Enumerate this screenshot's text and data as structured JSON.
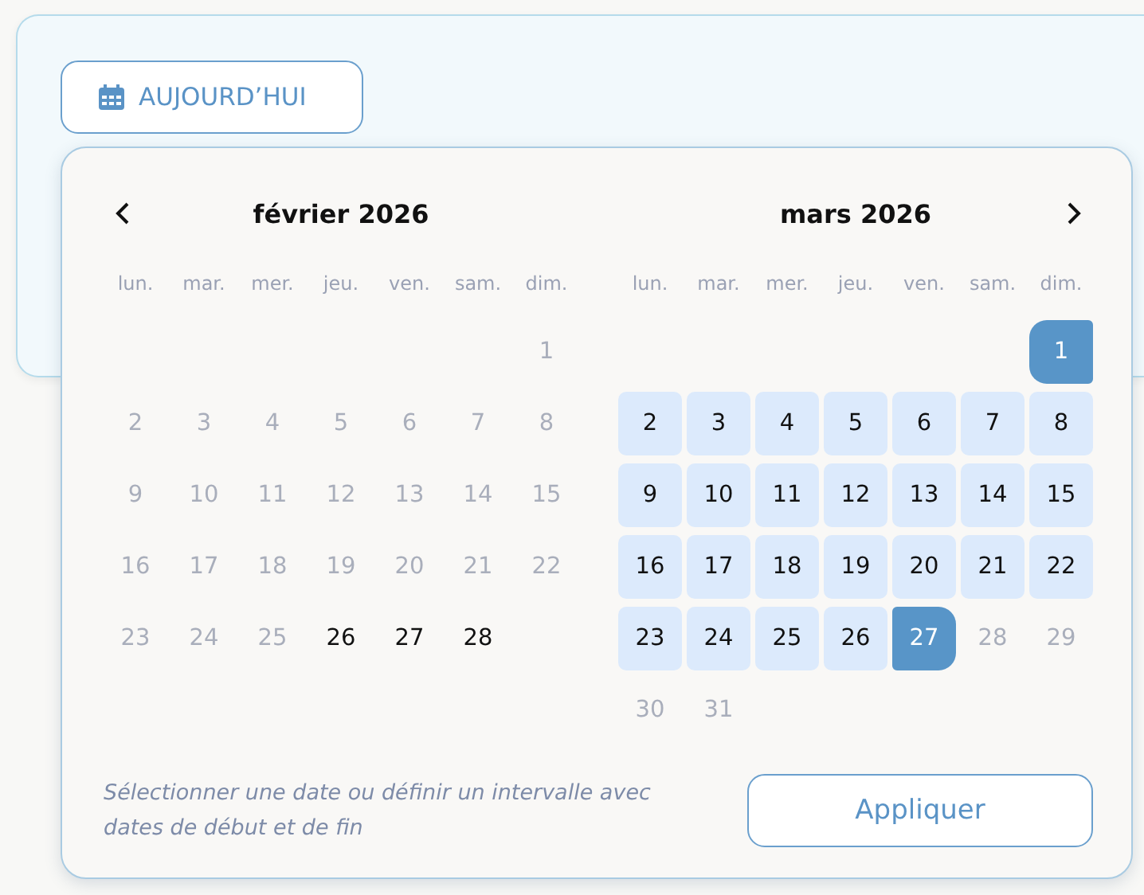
{
  "today_button": {
    "label": "AUJOURD’HUI"
  },
  "date_picker": {
    "months": [
      {
        "title": "février 2026",
        "weekdays": [
          "lun.",
          "mar.",
          "mer.",
          "jeu.",
          "ven.",
          "sam.",
          "dim."
        ],
        "weeks": [
          [
            {
              "kind": "blank"
            },
            {
              "kind": "blank"
            },
            {
              "kind": "blank"
            },
            {
              "kind": "blank"
            },
            {
              "kind": "blank"
            },
            {
              "kind": "blank"
            },
            {
              "kind": "muted",
              "label": "1"
            }
          ],
          [
            {
              "kind": "muted",
              "label": "2"
            },
            {
              "kind": "muted",
              "label": "3"
            },
            {
              "kind": "muted",
              "label": "4"
            },
            {
              "kind": "muted",
              "label": "5"
            },
            {
              "kind": "muted",
              "label": "6"
            },
            {
              "kind": "muted",
              "label": "7"
            },
            {
              "kind": "muted",
              "label": "8"
            }
          ],
          [
            {
              "kind": "muted",
              "label": "9"
            },
            {
              "kind": "muted",
              "label": "10"
            },
            {
              "kind": "muted",
              "label": "11"
            },
            {
              "kind": "muted",
              "label": "12"
            },
            {
              "kind": "muted",
              "label": "13"
            },
            {
              "kind": "muted",
              "label": "14"
            },
            {
              "kind": "muted",
              "label": "15"
            }
          ],
          [
            {
              "kind": "muted",
              "label": "16"
            },
            {
              "kind": "muted",
              "label": "17"
            },
            {
              "kind": "muted",
              "label": "18"
            },
            {
              "kind": "muted",
              "label": "19"
            },
            {
              "kind": "muted",
              "label": "20"
            },
            {
              "kind": "muted",
              "label": "21"
            },
            {
              "kind": "muted",
              "label": "22"
            }
          ],
          [
            {
              "kind": "muted",
              "label": "23"
            },
            {
              "kind": "muted",
              "label": "24"
            },
            {
              "kind": "muted",
              "label": "25"
            },
            {
              "kind": "plain",
              "label": "26"
            },
            {
              "kind": "plain",
              "label": "27"
            },
            {
              "kind": "plain",
              "label": "28"
            },
            {
              "kind": "blank"
            }
          ]
        ]
      },
      {
        "title": "mars 2026",
        "weekdays": [
          "lun.",
          "mar.",
          "mer.",
          "jeu.",
          "ven.",
          "sam.",
          "dim."
        ],
        "weeks": [
          [
            {
              "kind": "blank"
            },
            {
              "kind": "blank"
            },
            {
              "kind": "blank"
            },
            {
              "kind": "blank"
            },
            {
              "kind": "blank"
            },
            {
              "kind": "blank"
            },
            {
              "kind": "start",
              "label": "1"
            }
          ],
          [
            {
              "kind": "range",
              "label": "2"
            },
            {
              "kind": "range",
              "label": "3"
            },
            {
              "kind": "range",
              "label": "4"
            },
            {
              "kind": "range",
              "label": "5"
            },
            {
              "kind": "range",
              "label": "6"
            },
            {
              "kind": "range",
              "label": "7"
            },
            {
              "kind": "range",
              "label": "8"
            }
          ],
          [
            {
              "kind": "range",
              "label": "9"
            },
            {
              "kind": "range",
              "label": "10"
            },
            {
              "kind": "range",
              "label": "11"
            },
            {
              "kind": "range",
              "label": "12"
            },
            {
              "kind": "range",
              "label": "13"
            },
            {
              "kind": "range",
              "label": "14"
            },
            {
              "kind": "range",
              "label": "15"
            }
          ],
          [
            {
              "kind": "range",
              "label": "16"
            },
            {
              "kind": "range",
              "label": "17"
            },
            {
              "kind": "range",
              "label": "18"
            },
            {
              "kind": "range",
              "label": "19"
            },
            {
              "kind": "range",
              "label": "20"
            },
            {
              "kind": "range",
              "label": "21"
            },
            {
              "kind": "range",
              "label": "22"
            }
          ],
          [
            {
              "kind": "range",
              "label": "23"
            },
            {
              "kind": "range",
              "label": "24"
            },
            {
              "kind": "range",
              "label": "25"
            },
            {
              "kind": "range",
              "label": "26"
            },
            {
              "kind": "end",
              "label": "27"
            },
            {
              "kind": "muted",
              "label": "28"
            },
            {
              "kind": "muted",
              "label": "29"
            }
          ],
          [
            {
              "kind": "muted",
              "label": "30"
            },
            {
              "kind": "muted",
              "label": "31"
            },
            {
              "kind": "blank"
            },
            {
              "kind": "blank"
            },
            {
              "kind": "blank"
            },
            {
              "kind": "blank"
            },
            {
              "kind": "blank"
            }
          ]
        ]
      }
    ],
    "hint": "Sélectionner une date ou définir un intervalle avec dates de début et de fin",
    "apply_button": {
      "label": "Appliquer"
    }
  }
}
